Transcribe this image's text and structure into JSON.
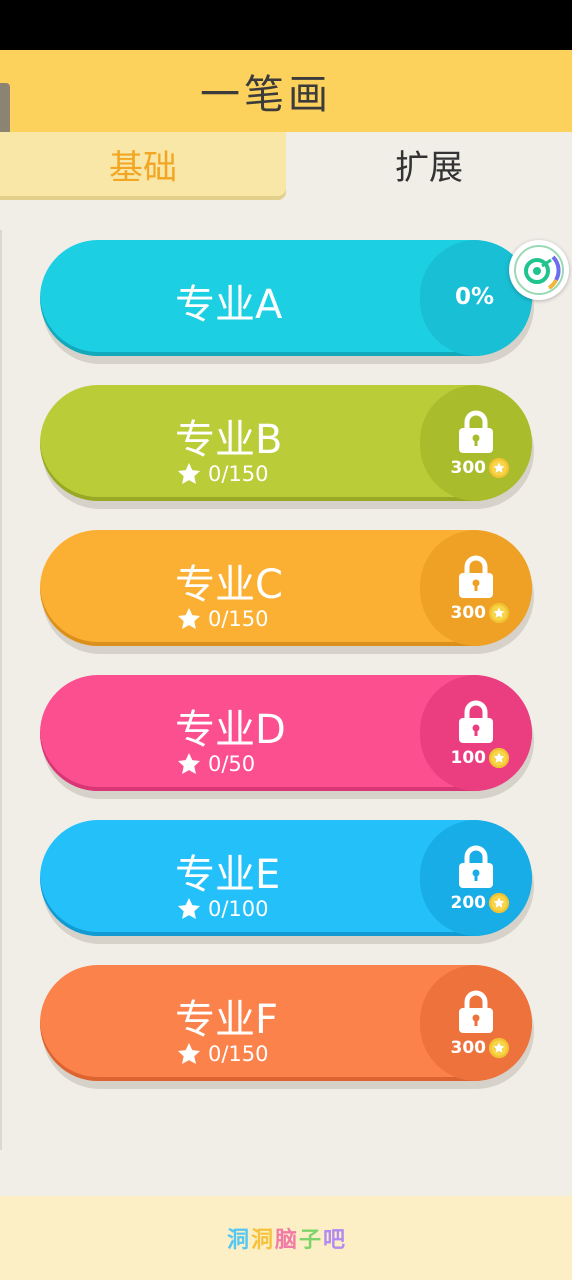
{
  "app": {
    "title": "一笔画"
  },
  "tabs": [
    {
      "label": "基础",
      "active": true
    },
    {
      "label": "扩展",
      "active": false
    }
  ],
  "levels": [
    {
      "name": "专业A",
      "progress": "0%",
      "locked": false,
      "color": "#1ccfe3",
      "side_color": "#19bfd4",
      "edge_color": "#14a8bb"
    },
    {
      "name": "专业B",
      "stars": "0/150",
      "cost": "300",
      "locked": true,
      "color": "#bacd38",
      "side_color": "#a9bc2b",
      "edge_color": "#98aa25"
    },
    {
      "name": "专业C",
      "stars": "0/150",
      "cost": "300",
      "locked": true,
      "color": "#fbb033",
      "side_color": "#efa125",
      "edge_color": "#dc901c"
    },
    {
      "name": "专业D",
      "stars": "0/50",
      "cost": "100",
      "locked": true,
      "color": "#fc4f8f",
      "side_color": "#ea3e80",
      "edge_color": "#d83674"
    },
    {
      "name": "专业E",
      "stars": "0/100",
      "cost": "200",
      "locked": true,
      "color": "#24c0fa",
      "side_color": "#18ade6",
      "edge_color": "#119bd2"
    },
    {
      "name": "专业F",
      "stars": "0/150",
      "cost": "300",
      "locked": true,
      "color": "#fc824c",
      "side_color": "#ee723c",
      "edge_color": "#dc6430"
    }
  ],
  "footer": {
    "brand_chars": [
      "洞",
      "洞",
      "脑",
      "子",
      "吧"
    ],
    "brand_colors": [
      "#56c7f0",
      "#f6c23e",
      "#f27aa6",
      "#7fd36a",
      "#b38bf0"
    ]
  },
  "icons": {
    "star": "star-icon",
    "lock": "lock-icon",
    "coin": "coin-icon",
    "badge": "assistant-badge-icon"
  }
}
